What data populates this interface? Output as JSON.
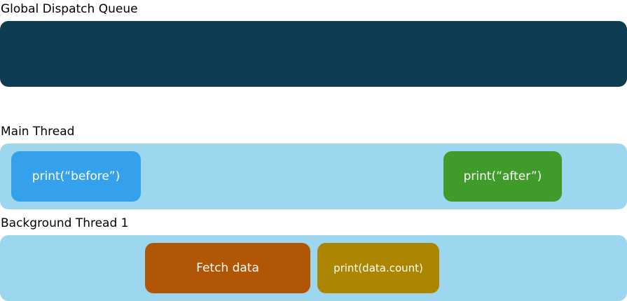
{
  "lanes": {
    "global_queue": {
      "label": "Global Dispatch Queue",
      "color": "#0e3c52"
    },
    "main_thread": {
      "label": "Main Thread",
      "color": "#9dd6ef"
    },
    "background_thread": {
      "label": "Background Thread 1",
      "color": "#9dd6ef"
    }
  },
  "tasks": {
    "print_before": {
      "label": "print(“before”)",
      "color": "#35a1ed"
    },
    "print_after": {
      "label": "print(“after”)",
      "color": "#3f9c2b"
    },
    "fetch_data": {
      "label": "Fetch data",
      "color": "#b05606"
    },
    "print_count": {
      "label": "print(data.count)",
      "color": "#ac8602"
    }
  }
}
